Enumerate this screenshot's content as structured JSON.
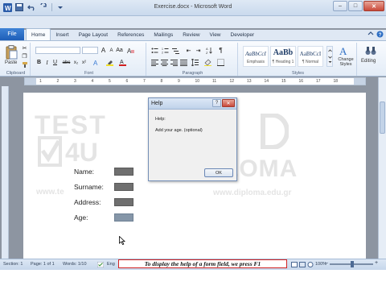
{
  "window": {
    "title": "Exercise.docx - Microsoft Word",
    "controls": {
      "minimize": "–",
      "maximize": "□",
      "close": "✕"
    }
  },
  "qat": {
    "icons": [
      "word-icon",
      "save-icon",
      "undo-icon",
      "redo-icon",
      "customize-icon"
    ]
  },
  "ribbon": {
    "tabs": [
      {
        "label": "File"
      },
      {
        "label": "Home",
        "active": true
      },
      {
        "label": "Insert"
      },
      {
        "label": "Page Layout"
      },
      {
        "label": "References"
      },
      {
        "label": "Mailings"
      },
      {
        "label": "Review"
      },
      {
        "label": "View"
      },
      {
        "label": "Developer"
      }
    ],
    "groups": {
      "clipboard": {
        "label": "Clipboard",
        "paste_label": "Paste"
      },
      "font": {
        "label": "Font"
      },
      "paragraph": {
        "label": "Paragraph"
      },
      "styles": {
        "label": "Styles",
        "items": [
          {
            "sample": "AaBbCcI",
            "name": "Emphasis"
          },
          {
            "sample": "AaBb",
            "name": "¶ Heading 1"
          },
          {
            "sample": "AaBbCcI",
            "name": "¶ Normal"
          }
        ],
        "change_styles_label": "Change Styles"
      },
      "editing": {
        "label": "Editing"
      }
    }
  },
  "ruler": {
    "marks": [
      "1",
      "2",
      "3",
      "4",
      "5",
      "6",
      "7",
      "8",
      "9",
      "10",
      "11",
      "12",
      "13",
      "14",
      "15",
      "16",
      "17",
      "18"
    ]
  },
  "watermark": {
    "brand_test": "TEST",
    "brand_4u": "4U",
    "diploma": "DIPLOMA",
    "url_left": "www.te",
    "url_right": "www.diploma.edu.gr"
  },
  "form": {
    "fields": [
      {
        "label": "Name:"
      },
      {
        "label": "Surname:"
      },
      {
        "label": "Address:"
      },
      {
        "label": "Age:",
        "selected": true
      }
    ]
  },
  "dialog": {
    "title": "Help",
    "heading": "Help:",
    "message": "Add your age. (optional)",
    "ok_label": "OK"
  },
  "statusbar": {
    "section": "Section: 1",
    "page": "Page: 1 of 1",
    "words": "Words: 1/10",
    "language": "Eng",
    "zoom": "100%",
    "zoom_out": "–",
    "zoom_in": "+"
  },
  "instruction": "To display the help of a form field, we press F1"
}
